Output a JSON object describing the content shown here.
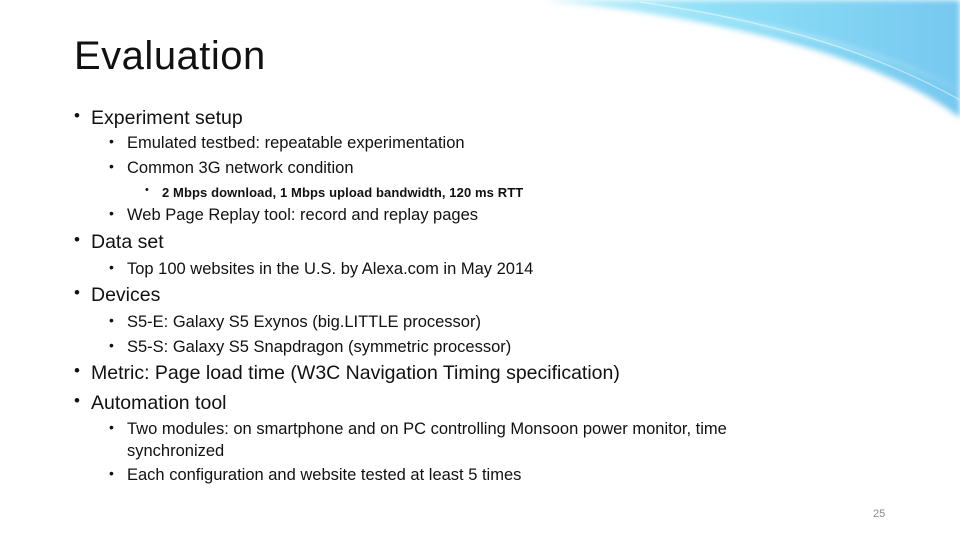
{
  "slide": {
    "title": "Evaluation",
    "page_number": "25",
    "accent_color": "#7cd6f2",
    "bullet_glyph": "•"
  },
  "bullets": [
    {
      "level": 1,
      "text": "Experiment setup"
    },
    {
      "level": 2,
      "text": "Emulated testbed: repeatable experimentation"
    },
    {
      "level": 2,
      "text": "Common 3G network condition"
    },
    {
      "level": 3,
      "text": "2 Mbps download, 1 Mbps upload bandwidth, 120 ms RTT"
    },
    {
      "level": 2,
      "text": "Web Page Replay tool: record and replay pages"
    },
    {
      "level": 1,
      "text": "Data set"
    },
    {
      "level": 2,
      "text": "Top 100 websites in the U.S. by Alexa.com in May 2014"
    },
    {
      "level": 1,
      "text": "Devices"
    },
    {
      "level": 2,
      "text": "S5-E: Galaxy S5 Exynos (big.LITTLE processor)"
    },
    {
      "level": 2,
      "text": "S5-S: Galaxy S5 Snapdragon (symmetric processor)"
    },
    {
      "level": 1,
      "text": "Metric: Page load time (W3C Navigation Timing specification)"
    },
    {
      "level": 1,
      "text": "Automation tool"
    },
    {
      "level": 2,
      "text": "Two modules: on smartphone and on PC controlling Monsoon power monitor, time",
      "continuation": "synchronized"
    },
    {
      "level": 2,
      "text": "Each configuration and website tested at least 5 times"
    }
  ]
}
